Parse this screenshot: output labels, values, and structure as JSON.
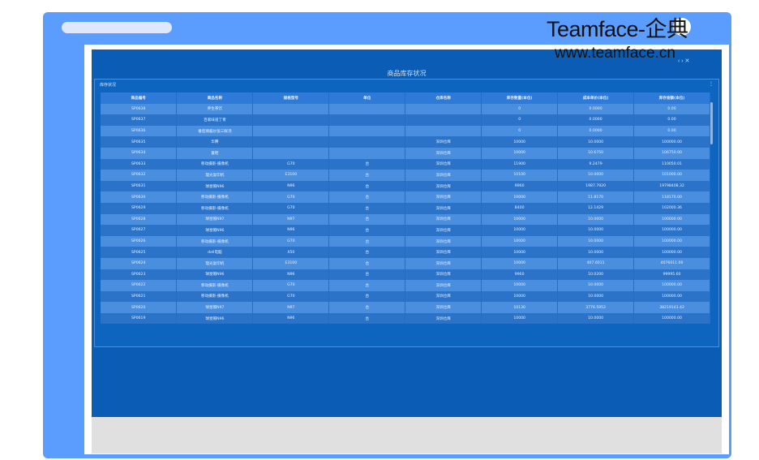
{
  "watermark": {
    "brand": "Teamface-企典",
    "url": "www.teamface.cn"
  },
  "screen": {
    "title": "商品库存状况",
    "window_controls": "‹  ›  ✕"
  },
  "panel": {
    "label": "库存状况",
    "menu_icon": "more-vertical-icon"
  },
  "table": {
    "headers": [
      "商品编号",
      "商品名称",
      "规格型号",
      "单位",
      "仓库名称",
      "库存数量(本位)",
      "成本单价(本位)",
      "库存金额(本位)"
    ],
    "rows": [
      [
        "SP0638",
        "养生茶饮",
        "",
        "",
        "",
        "0",
        "0.0000",
        "0.00"
      ],
      [
        "SP0637",
        "百家味道丁青",
        "",
        "",
        "",
        "0",
        "0.0000",
        "0.00"
      ],
      [
        "SP0636",
        "番茄辣酱炒饭三鲜汤",
        "",
        "",
        "",
        "0",
        "0.0000",
        "0.00"
      ],
      [
        "SP0635",
        "华腾",
        "",
        "",
        "深圳仓库",
        "10000",
        "10.0000",
        "100000.00"
      ],
      [
        "SP0634",
        "童鞋",
        "",
        "",
        "深圳仓库",
        "10000",
        "10.6750",
        "106750.00"
      ],
      [
        "SP0633",
        "移动摄影-摄像机",
        "G70",
        "台",
        "深圳仓库",
        "11900",
        "9.2479",
        "110050.01"
      ],
      [
        "SP0632",
        "理光复印机",
        "E3100",
        "台",
        "深圳仓库",
        "10100",
        "10.0000",
        "101000.00"
      ],
      [
        "SP0631",
        "球星帽N96",
        "N96",
        "台",
        "深圳仓库",
        "9960",
        "1987.7920",
        "19798408.32"
      ],
      [
        "SP0630",
        "移动摄影-摄像机",
        "G70",
        "台",
        "深圳仓库",
        "10000",
        "11.8170",
        "118170.00"
      ],
      [
        "SP0629",
        "移动摄影-摄像机",
        "G70",
        "台",
        "深圳仓库",
        "8400",
        "12.1429",
        "102000.36"
      ],
      [
        "SP0628",
        "球星帽N97",
        "N97",
        "台",
        "深圳仓库",
        "10000",
        "10.0000",
        "100000.00"
      ],
      [
        "SP0627",
        "球星帽N96",
        "N96",
        "台",
        "深圳仓库",
        "10000",
        "10.0000",
        "100000.00"
      ],
      [
        "SP0626",
        "移动摄影-摄像机",
        "G70",
        "台",
        "深圳仓库",
        "10000",
        "10.0000",
        "100000.00"
      ],
      [
        "SP0625",
        "dell电脑",
        "X50",
        "台",
        "深圳仓库",
        "10000",
        "10.0000",
        "100000.00"
      ],
      [
        "SP0624",
        "理光复印机",
        "E3100",
        "台",
        "深圳仓库",
        "10000",
        "407.6011",
        "4076011.00"
      ],
      [
        "SP0623",
        "球星帽N96",
        "N96",
        "台",
        "深圳仓库",
        "9960",
        "10.0200",
        "99995.60"
      ],
      [
        "SP0622",
        "移动摄影-摄像机",
        "G70",
        "台",
        "深圳仓库",
        "10000",
        "10.0000",
        "100000.00"
      ],
      [
        "SP0621",
        "移动摄影-摄像机",
        "G70",
        "台",
        "深圳仓库",
        "10000",
        "10.0000",
        "100000.00"
      ],
      [
        "SP0620",
        "球星帽N97",
        "N97",
        "台",
        "深圳仓库",
        "10130",
        "3776.5952",
        "38219143.42"
      ],
      [
        "SP0619",
        "球星帽N96",
        "N96",
        "台",
        "深圳仓库",
        "10000",
        "10.0000",
        "100000.00"
      ]
    ]
  }
}
